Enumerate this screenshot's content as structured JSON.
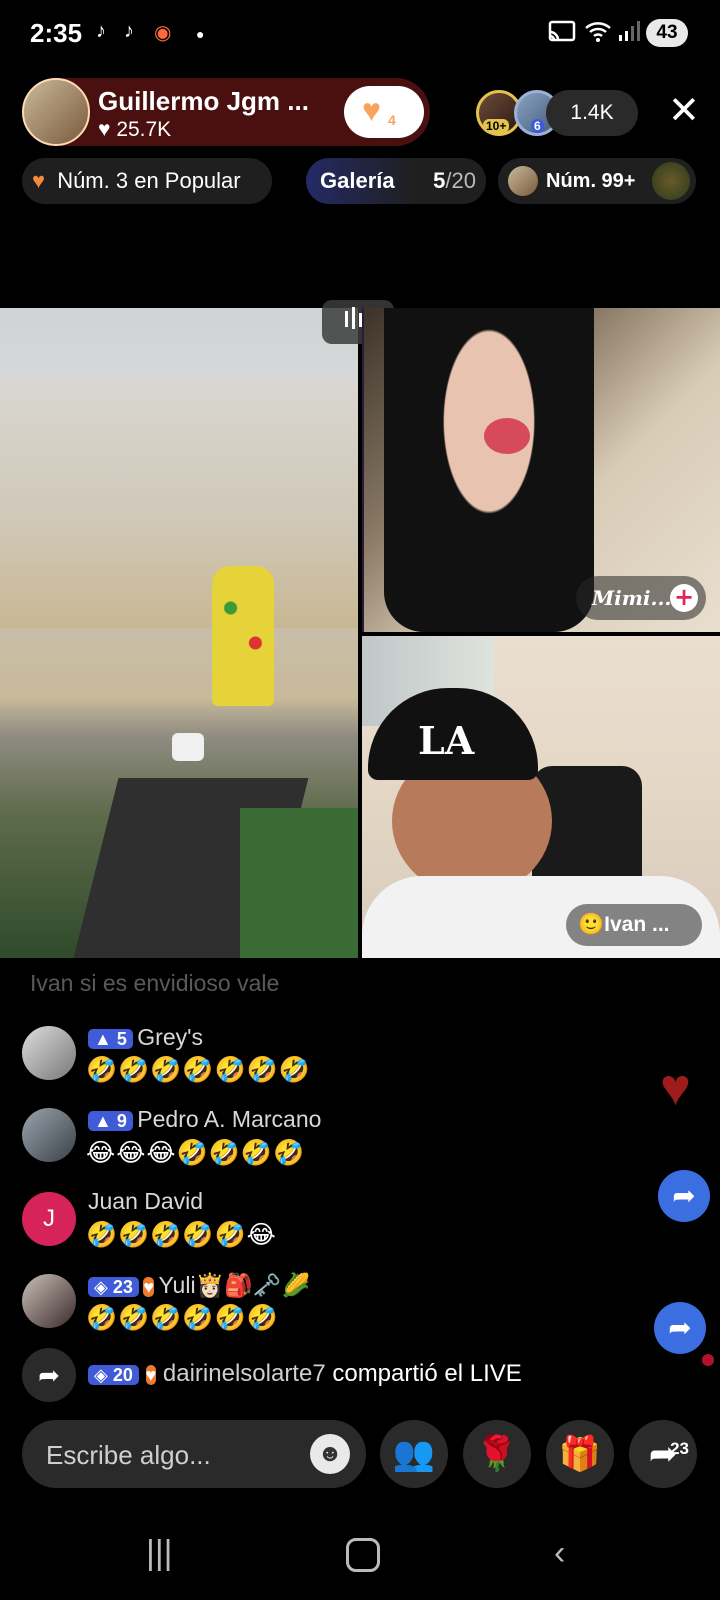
{
  "status_bar": {
    "time": "2:35",
    "left_icons": [
      "tiktok-icon",
      "tiktok-icon",
      "record-icon",
      "dot-icon"
    ],
    "right_icons": [
      "cast-icon",
      "wifi-5g-icon",
      "signal-icon"
    ],
    "battery": "43"
  },
  "host": {
    "name": "Guillermo Jgm ...",
    "likes": "25.7K",
    "follow_count": "4"
  },
  "viewers": {
    "badges": [
      "10+",
      "6"
    ],
    "count": "1.4K"
  },
  "chips": {
    "popular": "Núm. 3 en Popular",
    "gallery_label": "Galería",
    "gallery_current": "5",
    "gallery_total": "/20",
    "rank": "Núm. 99+"
  },
  "videos": {
    "guest_1": "Mimi...",
    "guest_2": "Ivan ...",
    "cap_logo": "LA"
  },
  "comments": {
    "faded": "Ivan si es envidioso vale",
    "items": [
      {
        "level": "5",
        "name": "Grey's",
        "message": "🤣🤣🤣🤣🤣🤣🤣"
      },
      {
        "level": "9",
        "name": "Pedro A. Marcano",
        "message": "😂😂😂🤣🤣🤣🤣"
      },
      {
        "avatar_letter": "J",
        "name": "Juan David",
        "message": "🤣🤣🤣🤣🤣😂"
      },
      {
        "level": "23",
        "name": "Yuli👸🏻🎒🗝️🌽",
        "message": "🤣🤣🤣🤣🤣🤣"
      }
    ],
    "share_event": {
      "level": "20",
      "user": "dairinelsolarte7",
      "text": "compartió el LIVE"
    }
  },
  "bottom_bar": {
    "placeholder": "Escribe algo...",
    "share_count": "23"
  },
  "colors": {
    "accent_red": "#e2245b",
    "badge_blue": "#3f5bd8",
    "fab_blue": "#3b6ee0"
  }
}
